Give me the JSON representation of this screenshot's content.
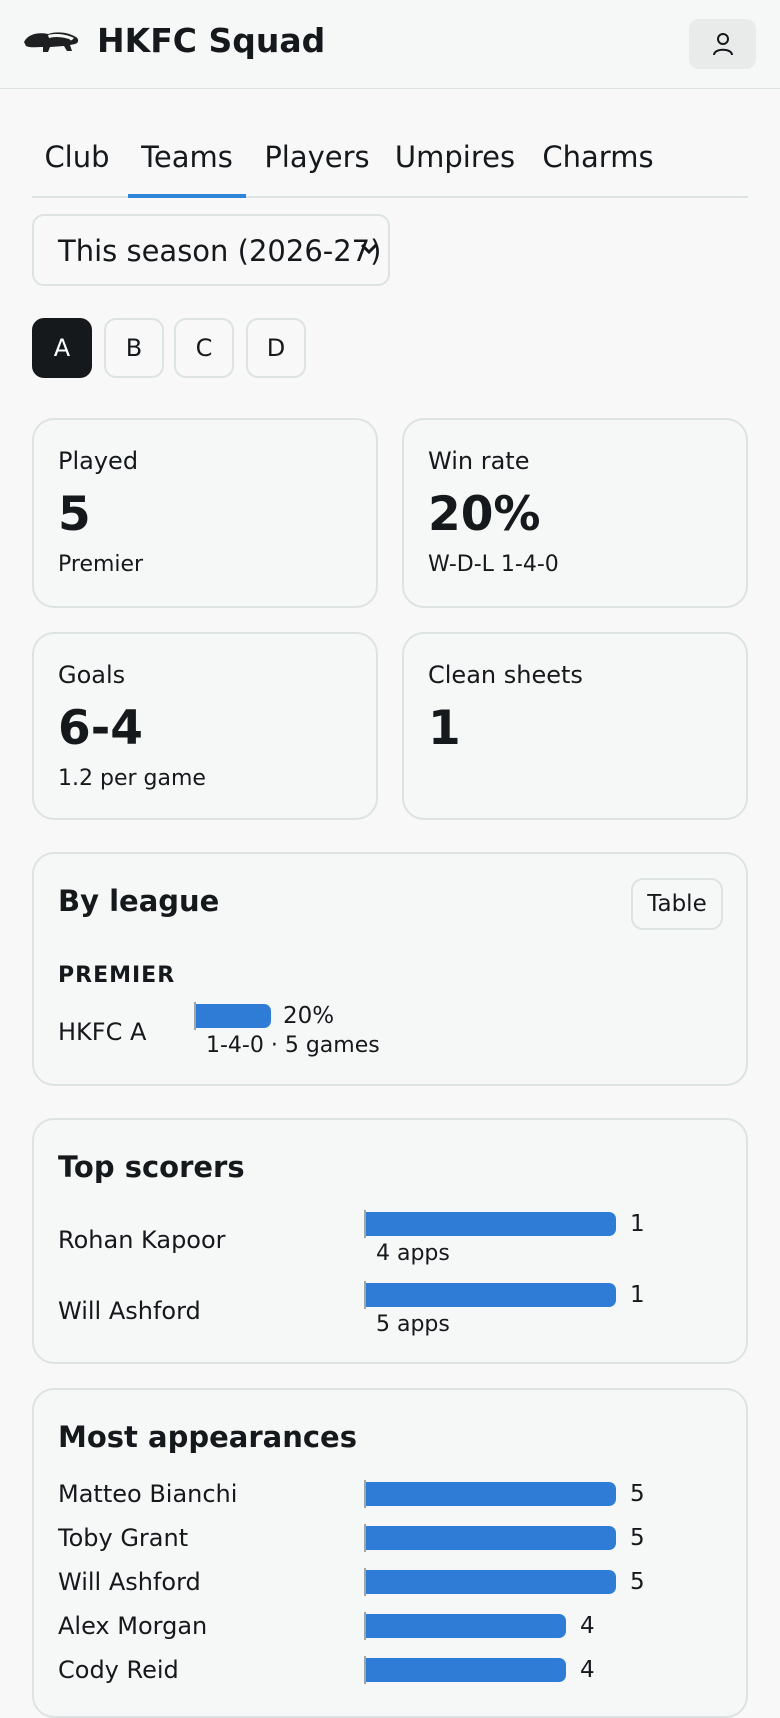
{
  "header": {
    "title": "HKFC Squad",
    "logo_icon": "badger-logo-icon",
    "profile_icon": "user-icon"
  },
  "tabs": [
    {
      "label": "Club",
      "active": false
    },
    {
      "label": "Teams",
      "active": true
    },
    {
      "label": "Players",
      "active": false
    },
    {
      "label": "Umpires",
      "active": false
    },
    {
      "label": "Charms",
      "active": false
    }
  ],
  "season_select": {
    "value": "This season (2026-27)",
    "icon": "chevron-down-icon"
  },
  "team_selector": [
    {
      "label": "A",
      "active": true
    },
    {
      "label": "B",
      "active": false
    },
    {
      "label": "C",
      "active": false
    },
    {
      "label": "D",
      "active": false
    }
  ],
  "stats": {
    "played": {
      "label": "Played",
      "value": "5",
      "sub": "Premier"
    },
    "win_rate": {
      "label": "Win rate",
      "value": "20%",
      "sub": "W-D-L 1-4-0"
    },
    "goals": {
      "label": "Goals",
      "value": "6-4",
      "sub": "1.2 per game"
    },
    "clean_sheets": {
      "label": "Clean sheets",
      "value": "1"
    }
  },
  "by_league": {
    "title": "By league",
    "table_button": "Table",
    "league": "PREMIER",
    "rows": [
      {
        "team": "HKFC A",
        "win_rate": 20,
        "value_label": "20%",
        "sub": "1-4-0 · 5 games"
      }
    ]
  },
  "top_scorers": {
    "title": "Top scorers",
    "rows": [
      {
        "name": "Rohan Kapoor",
        "goals": 1,
        "sub": "4 apps"
      },
      {
        "name": "Will Ashford",
        "goals": 1,
        "sub": "5 apps"
      }
    ]
  },
  "most_appearances": {
    "title": "Most appearances",
    "rows": [
      {
        "name": "Matteo Bianchi",
        "apps": 5
      },
      {
        "name": "Toby Grant",
        "apps": 5
      },
      {
        "name": "Will Ashford",
        "apps": 5
      },
      {
        "name": "Alex Morgan",
        "apps": 4
      },
      {
        "name": "Cody Reid",
        "apps": 4
      }
    ]
  },
  "colors": {
    "accent": "#2e84d6",
    "bar": "#2e7cd6",
    "text": "#15191c",
    "border": "#dde3e3",
    "background": "#f8f8f8"
  }
}
